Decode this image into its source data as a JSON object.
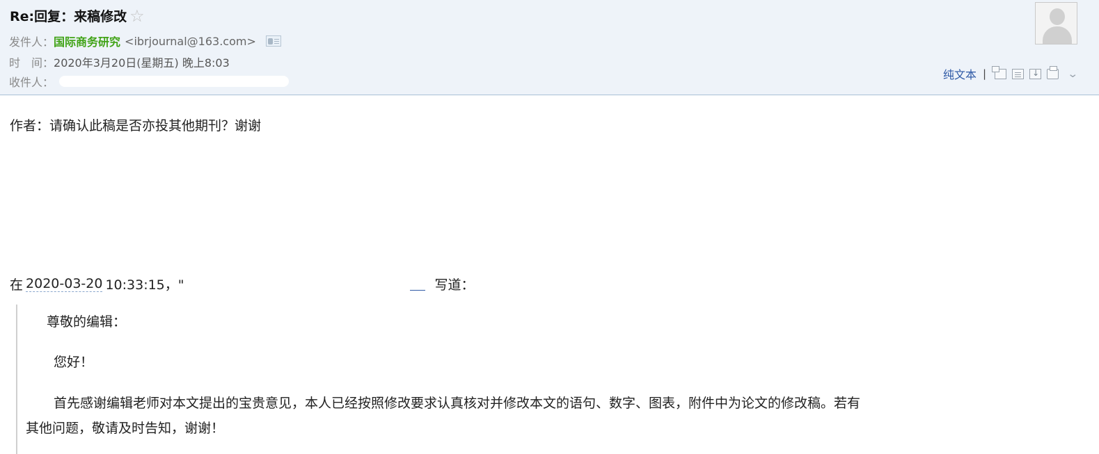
{
  "subject": "Re:回复：来稿修改",
  "icons": {
    "star": "star-outline-icon",
    "contact_card": "contact-card-icon",
    "avatar": "avatar-icon"
  },
  "sender": {
    "label": "发件人：",
    "name": "国际商务研究",
    "email": "<ibrjournal@163.com>"
  },
  "time": {
    "label": "时　间：",
    "value": "2020年3月20日(星期五) 晚上8:03"
  },
  "recipient": {
    "label": "收件人："
  },
  "toolbar": {
    "plain_text": "纯文本",
    "separator": "|"
  },
  "body": {
    "reply": "作者：请确认此稿是否亦投其他期刊？谢谢"
  },
  "quote": {
    "prefix": "在",
    "date": "2020-03-20",
    "time": "10:33:15，\"",
    "suffix": "写道："
  },
  "quoted": {
    "greeting": "尊敬的编辑：",
    "hello": "您好！",
    "para1_line1": "首先感谢编辑老师对本文提出的宝贵意见，本人已经按照修改要求认真核对并修改本文的语句、数字、图表，附件中为论文的修改稿。若有",
    "para1_line2": "其他问题，敬请及时告知，谢谢！"
  }
}
